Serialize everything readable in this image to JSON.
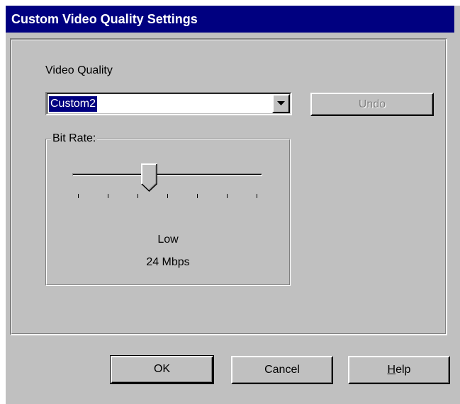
{
  "window": {
    "title": "Custom Video Quality Settings"
  },
  "video_quality": {
    "label": "Video Quality",
    "selected": "Custom2"
  },
  "bit_rate": {
    "legend": "Bit Rate:",
    "level_label": "Low",
    "value_label": "24 Mbps",
    "slider_fraction": 0.4,
    "tick_count": 7
  },
  "buttons": {
    "undo": "Undo",
    "ok": "OK",
    "cancel": "Cancel",
    "help": "Help"
  },
  "colors": {
    "titlebar": "#000080",
    "face": "#c0c0c0",
    "selection": "#000080"
  },
  "icons": {
    "dropdown": "chevron-down-icon",
    "slider": "slider-thumb-icon"
  }
}
